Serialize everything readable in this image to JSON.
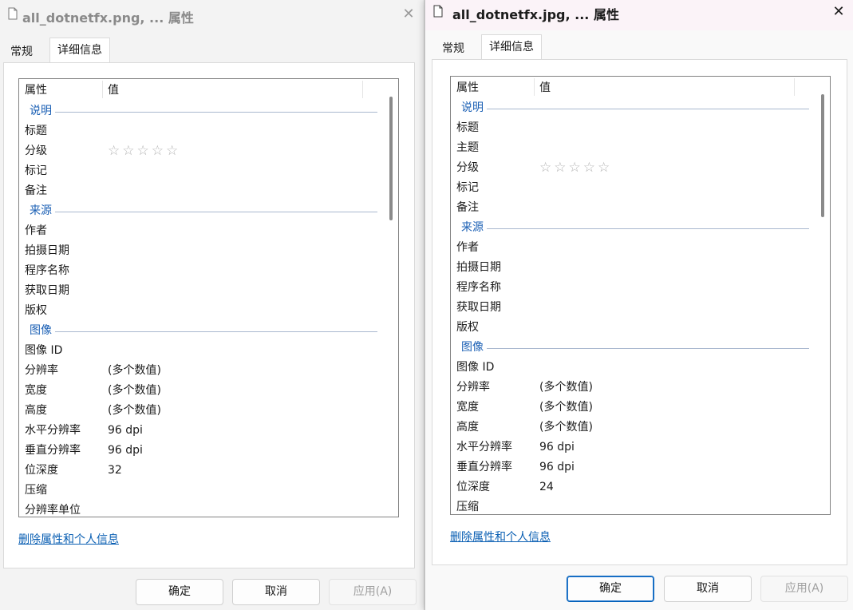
{
  "left_window": {
    "title": "all_dotnetfx.png, ... 属性",
    "tabs": [
      "常规",
      "详细信息"
    ],
    "columns": {
      "name": "属性",
      "value": "值"
    },
    "rows": [
      {
        "type": "group",
        "name": "说明"
      },
      {
        "type": "prop",
        "name": "标题",
        "value": ""
      },
      {
        "type": "rating",
        "name": "分级",
        "value": "☆☆☆☆☆"
      },
      {
        "type": "prop",
        "name": "标记",
        "value": ""
      },
      {
        "type": "prop",
        "name": "备注",
        "value": ""
      },
      {
        "type": "group",
        "name": "来源"
      },
      {
        "type": "prop",
        "name": "作者",
        "value": ""
      },
      {
        "type": "prop",
        "name": "拍摄日期",
        "value": ""
      },
      {
        "type": "prop",
        "name": "程序名称",
        "value": ""
      },
      {
        "type": "prop",
        "name": "获取日期",
        "value": ""
      },
      {
        "type": "prop",
        "name": "版权",
        "value": ""
      },
      {
        "type": "group",
        "name": "图像"
      },
      {
        "type": "prop",
        "name": "图像 ID",
        "value": ""
      },
      {
        "type": "prop",
        "name": "分辨率",
        "value": "(多个数值)"
      },
      {
        "type": "prop",
        "name": "宽度",
        "value": "(多个数值)"
      },
      {
        "type": "prop",
        "name": "高度",
        "value": "(多个数值)"
      },
      {
        "type": "prop",
        "name": "水平分辨率",
        "value": "96 dpi"
      },
      {
        "type": "prop",
        "name": "垂直分辨率",
        "value": "96 dpi"
      },
      {
        "type": "prop",
        "name": "位深度",
        "value": "32"
      },
      {
        "type": "prop",
        "name": "压缩",
        "value": ""
      },
      {
        "type": "prop",
        "name": "分辨率单位",
        "value": ""
      }
    ],
    "remove_link": "删除属性和个人信息",
    "buttons": {
      "ok": "确定",
      "cancel": "取消",
      "apply": "应用(A)"
    }
  },
  "right_window": {
    "title": "all_dotnetfx.jpg, ... 属性",
    "tabs": [
      "常规",
      "详细信息"
    ],
    "columns": {
      "name": "属性",
      "value": "值"
    },
    "rows": [
      {
        "type": "group",
        "name": "说明"
      },
      {
        "type": "prop",
        "name": "标题",
        "value": ""
      },
      {
        "type": "prop",
        "name": "主题",
        "value": ""
      },
      {
        "type": "rating",
        "name": "分级",
        "value": "☆☆☆☆☆"
      },
      {
        "type": "prop",
        "name": "标记",
        "value": ""
      },
      {
        "type": "prop",
        "name": "备注",
        "value": ""
      },
      {
        "type": "group",
        "name": "来源"
      },
      {
        "type": "prop",
        "name": "作者",
        "value": ""
      },
      {
        "type": "prop",
        "name": "拍摄日期",
        "value": ""
      },
      {
        "type": "prop",
        "name": "程序名称",
        "value": ""
      },
      {
        "type": "prop",
        "name": "获取日期",
        "value": ""
      },
      {
        "type": "prop",
        "name": "版权",
        "value": ""
      },
      {
        "type": "group",
        "name": "图像"
      },
      {
        "type": "prop",
        "name": "图像 ID",
        "value": ""
      },
      {
        "type": "prop",
        "name": "分辨率",
        "value": "(多个数值)"
      },
      {
        "type": "prop",
        "name": "宽度",
        "value": "(多个数值)"
      },
      {
        "type": "prop",
        "name": "高度",
        "value": "(多个数值)"
      },
      {
        "type": "prop",
        "name": "水平分辨率",
        "value": "96 dpi"
      },
      {
        "type": "prop",
        "name": "垂直分辨率",
        "value": "96 dpi"
      },
      {
        "type": "prop",
        "name": "位深度",
        "value": "24"
      },
      {
        "type": "prop",
        "name": "压缩",
        "value": ""
      }
    ],
    "remove_link": "删除属性和个人信息",
    "buttons": {
      "ok": "确定",
      "cancel": "取消",
      "apply": "应用(A)"
    }
  },
  "icons": {
    "title": "document-icon",
    "close": "close-icon"
  },
  "colors": {
    "group_header": "#1a5fb4",
    "link": "#0a5fb3",
    "primary_border": "#005fb8"
  }
}
